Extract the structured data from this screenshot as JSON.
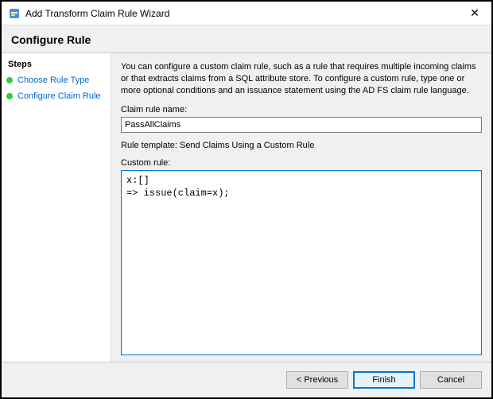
{
  "window": {
    "title": "Add Transform Claim Rule Wizard",
    "close_glyph": "✕"
  },
  "header": {
    "title": "Configure Rule"
  },
  "sidebar": {
    "heading": "Steps",
    "items": [
      {
        "label": "Choose Rule Type"
      },
      {
        "label": "Configure Claim Rule"
      }
    ]
  },
  "main": {
    "description": "You can configure a custom claim rule, such as a rule that requires multiple incoming claims or that extracts claims from a SQL attribute store. To configure a custom rule, type one or more optional conditions and an issuance statement using the AD FS claim rule language.",
    "name_label": "Claim rule name:",
    "name_value": "PassAllClaims",
    "template_label": "Rule template: Send Claims Using a Custom Rule",
    "custom_label": "Custom rule:",
    "custom_value": "x:[]\n=> issue(claim=x);"
  },
  "footer": {
    "previous": "< Previous",
    "finish": "Finish",
    "cancel": "Cancel"
  }
}
